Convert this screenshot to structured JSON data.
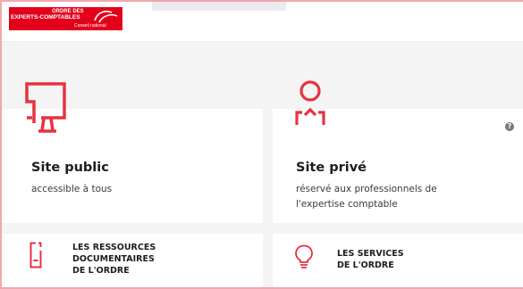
{
  "header": {
    "logo": {
      "line1": "ORDRE DES",
      "line2": "EXPERTS-COMPTABLES",
      "line3": "Conseil national"
    }
  },
  "sites": [
    {
      "icon": "monitor-icon",
      "title": "Site public",
      "subtitle": "accessible à tous"
    },
    {
      "icon": "user-icon",
      "title": "Site privé",
      "subtitle_line1": "réservé aux professionnels de",
      "subtitle_line2": "l'expertise comptable"
    }
  ],
  "resources": [
    {
      "icon": "document-icon",
      "line1": "LES RESSOURCES",
      "line2": "DOCUMENTAIRES",
      "line3": "DE L'ORDRE"
    },
    {
      "icon": "lightbulb-icon",
      "line1": "LES SERVICES",
      "line2": "DE L'ORDRE"
    }
  ],
  "help": {
    "glyph": "?"
  },
  "colors": {
    "accent": "#e3001b",
    "icon_red": "#e8323f",
    "text": "#1d1d22",
    "background": "#f4f4f5",
    "border": "#f2a7ad"
  }
}
